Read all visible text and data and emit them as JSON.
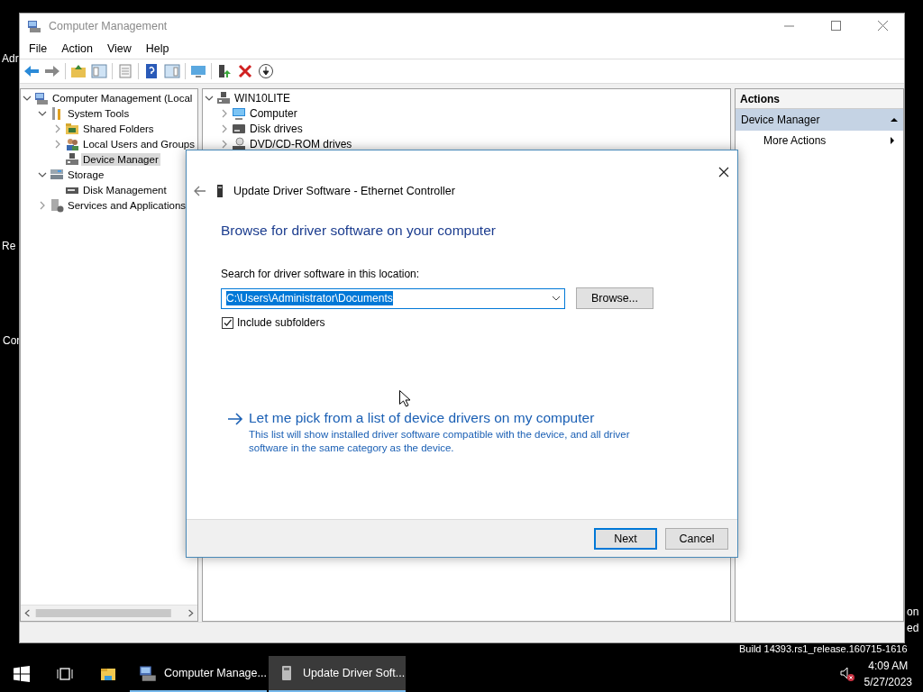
{
  "desktop": {
    "labels": [
      "Adr",
      "Re",
      "Cor",
      "on",
      "ed",
      "Build 14393.rs1_release.160715-1616"
    ]
  },
  "window": {
    "title": "Computer Management",
    "menu": [
      "File",
      "Action",
      "View",
      "Help"
    ],
    "left_tree": [
      {
        "label": "Computer Management (Local",
        "expanded": true,
        "selected": false,
        "children": [
          {
            "label": "System Tools",
            "expanded": true,
            "selected": false,
            "children": [
              {
                "label": "Shared Folders",
                "expanded": false,
                "selected": false
              },
              {
                "label": "Local Users and Groups",
                "expanded": false,
                "selected": false
              },
              {
                "label": "Device Manager",
                "selected": true
              }
            ]
          },
          {
            "label": "Storage",
            "expanded": true,
            "selected": false,
            "children": [
              {
                "label": "Disk Management",
                "selected": false
              }
            ]
          },
          {
            "label": "Services and Applications",
            "expanded": false,
            "selected": false
          }
        ]
      }
    ],
    "device_tree": [
      {
        "label": "WIN10LITE",
        "expanded": true,
        "children": [
          {
            "label": "Computer",
            "expanded": false
          },
          {
            "label": "Disk drives",
            "expanded": false
          },
          {
            "label": "DVD/CD-ROM drives",
            "expanded": false
          }
        ]
      }
    ],
    "actions": {
      "header": "Actions",
      "section": "Device Manager",
      "expanded": true,
      "items": [
        "More Actions"
      ]
    }
  },
  "dialog": {
    "title": "Update Driver Software - Ethernet Controller",
    "heading": "Browse for driver software on your computer",
    "location_label": "Search for driver software in this location:",
    "location_value": "C:\\Users\\Administrator\\Documents",
    "browse_button": "Browse...",
    "include_subfolders": {
      "label": "Include subfolders",
      "checked": true
    },
    "link": {
      "title": "Let me pick from a list of device drivers on my computer",
      "description": "This list will show installed driver software compatible with the device, and all driver software in the same category as the device."
    },
    "buttons": [
      {
        "label": "Next",
        "default": true
      },
      {
        "label": "Cancel",
        "default": false
      }
    ]
  },
  "taskbar": {
    "apps": [
      {
        "label": "Computer Manage...",
        "selected": false
      },
      {
        "label": "Update Driver Soft...",
        "selected": true
      }
    ],
    "time": "4:09 AM",
    "date": "5/27/2023"
  }
}
